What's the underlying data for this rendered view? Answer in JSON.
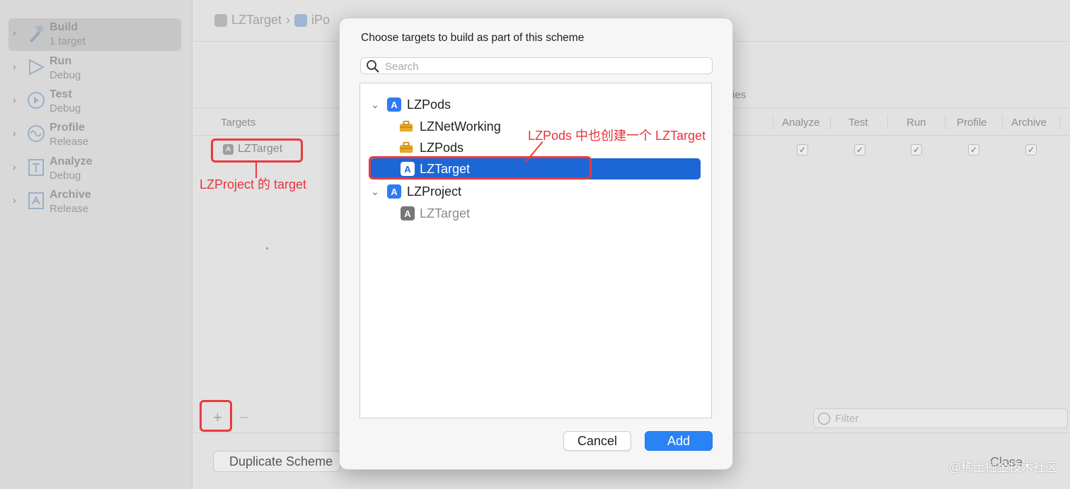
{
  "sidebar": {
    "actions": [
      {
        "name": "Build",
        "sub": "1 target",
        "icon": "hammer-icon"
      },
      {
        "name": "Run",
        "sub": "Debug",
        "icon": "play-icon"
      },
      {
        "name": "Test",
        "sub": "Debug",
        "icon": "test-diamond-icon"
      },
      {
        "name": "Profile",
        "sub": "Release",
        "icon": "waveform-icon"
      },
      {
        "name": "Analyze",
        "sub": "Debug",
        "icon": "analyze-icon"
      },
      {
        "name": "Archive",
        "sub": "Release",
        "icon": "archive-icon"
      }
    ]
  },
  "path_bar": {
    "target": "LZTarget",
    "device": "iPo"
  },
  "table": {
    "targets_header": "Targets",
    "partial_header": "ies",
    "columns": [
      "Analyze",
      "Test",
      "Run",
      "Profile",
      "Archive"
    ],
    "rows": [
      {
        "name": "LZTarget",
        "checks": [
          true,
          true,
          true,
          true,
          true
        ]
      }
    ]
  },
  "bottom": {
    "add_symbol": "+",
    "remove_symbol": "−",
    "filter_placeholder": "Filter",
    "duplicate_label": "Duplicate Scheme",
    "close_label": "Close"
  },
  "modal": {
    "title": "Choose targets to build as part of this scheme",
    "search_placeholder": "Search",
    "items": [
      {
        "label": "LZPods",
        "level": 0,
        "expanded": true,
        "icon": "app-project-icon"
      },
      {
        "label": "LZNetWorking",
        "level": 1,
        "icon": "toolbox-icon"
      },
      {
        "label": "LZPods",
        "level": 1,
        "icon": "toolbox-icon"
      },
      {
        "label": "LZTarget",
        "level": 1,
        "selected": true,
        "icon": "app-target-icon"
      },
      {
        "label": "LZProject",
        "level": 0,
        "expanded": true,
        "icon": "app-project-icon"
      },
      {
        "label": "LZTarget",
        "level": 1,
        "disabled": true,
        "icon": "app-target-icon"
      }
    ],
    "cancel_label": "Cancel",
    "add_label": "Add"
  },
  "annotations": {
    "pods_note": "LZPods 中也创建一个 LZTarget",
    "project_note": "LZProject 的 target",
    "color": "#e83a3e"
  },
  "watermark": "@稀土掘金技术社区",
  "colors": {
    "selection": "#1d66d6",
    "accent_button": "#2a83f4",
    "annotation": "#e83a3e"
  }
}
